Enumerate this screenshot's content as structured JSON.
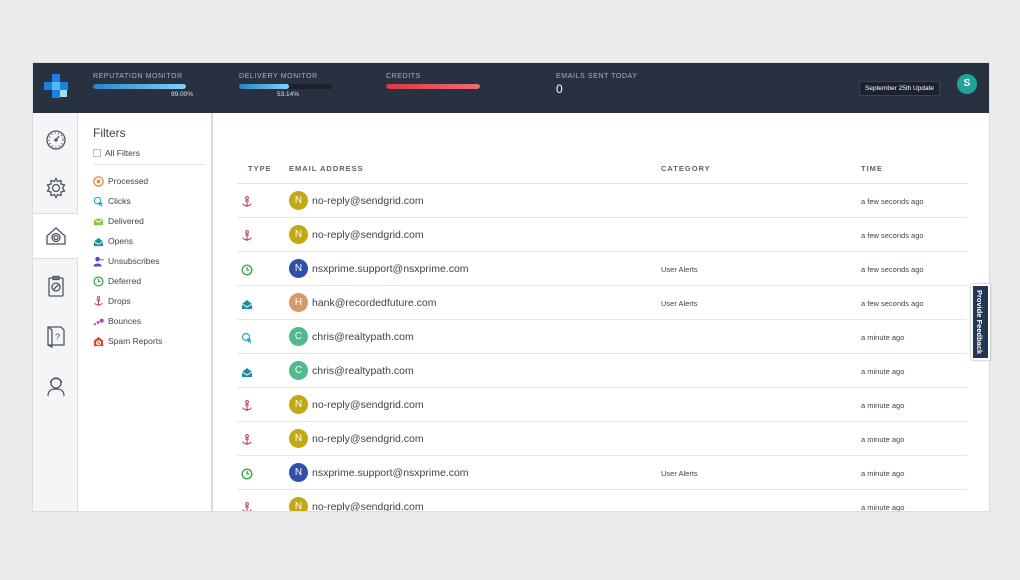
{
  "topbar": {
    "reputation": {
      "label": "REPUTATION MONITOR",
      "value": "99.00%",
      "fill": 0.99
    },
    "delivery": {
      "label": "DELIVERY MONITOR",
      "value": "53.14%",
      "fill": 0.5314
    },
    "credits": {
      "label": "CREDITS",
      "fill": 1.0
    },
    "emails_sent": {
      "label": "EMAILS SENT TODAY",
      "value": "0"
    },
    "update_badge": "September 25th Update",
    "user_initial": "S",
    "colors": {
      "bar": "#283140",
      "accent": "#1fa39b",
      "credits": "#e04652"
    }
  },
  "rail": [
    "dashboard-icon",
    "settings-icon",
    "activity-icon",
    "suppressions-icon",
    "help-icon",
    "support-icon"
  ],
  "filters": {
    "title": "Filters",
    "all_label": "All Filters",
    "items": [
      {
        "label": "Processed",
        "icon": "processed-icon",
        "color": "#e8873a"
      },
      {
        "label": "Clicks",
        "icon": "clicks-icon",
        "color": "#2aa3c9"
      },
      {
        "label": "Delivered",
        "icon": "delivered-icon",
        "color": "#8cc63f"
      },
      {
        "label": "Opens",
        "icon": "opens-icon",
        "color": "#1a8fa0"
      },
      {
        "label": "Unsubscribes",
        "icon": "unsubscribes-icon",
        "color": "#4a4fc2"
      },
      {
        "label": "Deferred",
        "icon": "deferred-icon",
        "color": "#3aaa45"
      },
      {
        "label": "Drops",
        "icon": "drops-icon",
        "color": "#c2487a"
      },
      {
        "label": "Bounces",
        "icon": "bounces-icon",
        "color": "#b23fbf"
      },
      {
        "label": "Spam Reports",
        "icon": "spam-icon",
        "color": "#d9452f"
      }
    ]
  },
  "table": {
    "headers": {
      "type": "TYPE",
      "email": "EMAIL ADDRESS",
      "category": "CATEGORY",
      "time": "TIME"
    },
    "rows": [
      {
        "type": "drops-icon",
        "initial": "N",
        "avatar_color": "#c4a812",
        "email": "no-reply@sendgrid.com",
        "category": "",
        "time": "a few seconds ago"
      },
      {
        "type": "drops-icon",
        "initial": "N",
        "avatar_color": "#c4a812",
        "email": "no-reply@sendgrid.com",
        "category": "",
        "time": "a few seconds ago"
      },
      {
        "type": "deferred-icon",
        "initial": "N",
        "avatar_color": "#2f4fa8",
        "email": "nsxprime.support@nsxprime.com",
        "category": "User Alerts",
        "time": "a few seconds ago"
      },
      {
        "type": "opens-icon",
        "initial": "H",
        "avatar_color": "#d59a6a",
        "email": "hank@recordedfuture.com",
        "category": "User Alerts",
        "time": "a few seconds ago"
      },
      {
        "type": "clicks-icon",
        "initial": "C",
        "avatar_color": "#4fba8c",
        "email": "chris@realtypath.com",
        "category": "",
        "time": "a minute ago"
      },
      {
        "type": "opens-icon",
        "initial": "C",
        "avatar_color": "#4fba8c",
        "email": "chris@realtypath.com",
        "category": "",
        "time": "a minute ago"
      },
      {
        "type": "drops-icon",
        "initial": "N",
        "avatar_color": "#c4a812",
        "email": "no-reply@sendgrid.com",
        "category": "",
        "time": "a minute ago"
      },
      {
        "type": "drops-icon",
        "initial": "N",
        "avatar_color": "#c4a812",
        "email": "no-reply@sendgrid.com",
        "category": "",
        "time": "a minute ago"
      },
      {
        "type": "deferred-icon",
        "initial": "N",
        "avatar_color": "#2f4fa8",
        "email": "nsxprime.support@nsxprime.com",
        "category": "User Alerts",
        "time": "a minute ago"
      },
      {
        "type": "drops-icon",
        "initial": "N",
        "avatar_color": "#c4a812",
        "email": "no-reply@sendgrid.com",
        "category": "",
        "time": "a minute ago"
      }
    ]
  },
  "feedback_label": "Provide Feedback"
}
